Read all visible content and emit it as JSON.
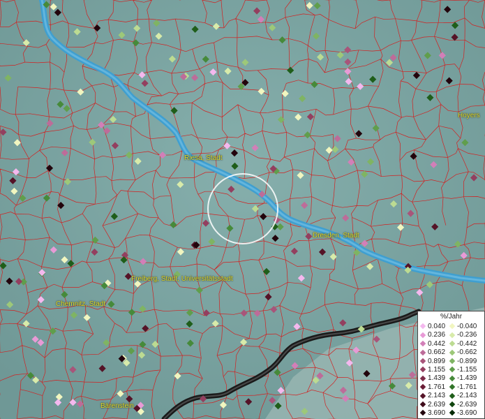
{
  "map": {
    "cities": {
      "riesa": "Riesa, Stadt",
      "dresden": "Dresden, Stadt",
      "freiberg": "Freiberg, Stadt, Universitätsstadt",
      "chemnitz": "Chemnitz, Stadt",
      "barenstein": "Bärenstein",
      "hoyers": "Hoyers"
    },
    "colors": {
      "terrain": "#7fa7a5",
      "river": "#3f9fd0",
      "boundaries": "#d22020",
      "border": "#1a1a1a",
      "selection_circle": "#ffffff"
    }
  },
  "legend": {
    "title": "%/Jahr",
    "positive": [
      {
        "label": "0.040",
        "color": "#f4b8ee"
      },
      {
        "label": "0.236",
        "color": "#e89ad6"
      },
      {
        "label": "0.442",
        "color": "#d27fb8"
      },
      {
        "label": "0.662",
        "color": "#bd6c99"
      },
      {
        "label": "0.899",
        "color": "#a8557a"
      },
      {
        "label": "1.155",
        "color": "#933f5f"
      },
      {
        "label": "1.439",
        "color": "#7d2c49"
      },
      {
        "label": "1.761",
        "color": "#6a1d36"
      },
      {
        "label": "2.143",
        "color": "#551327"
      },
      {
        "label": "2.639",
        "color": "#3e0b1a"
      },
      {
        "label": "3.690",
        "color": "#22040c"
      }
    ],
    "negative": [
      {
        "label": "-0.040",
        "color": "#f1f6c0"
      },
      {
        "label": "-0.236",
        "color": "#d8ebaa"
      },
      {
        "label": "-0.442",
        "color": "#bcdb92"
      },
      {
        "label": "-0.662",
        "color": "#9dc879"
      },
      {
        "label": "-0.899",
        "color": "#7fb463"
      },
      {
        "label": "-1.155",
        "color": "#609e4c"
      },
      {
        "label": "-1.439",
        "color": "#468a3a"
      },
      {
        "label": "-1.761",
        "color": "#317429"
      },
      {
        "label": "-2.143",
        "color": "#1f5e1a"
      },
      {
        "label": "-2.639",
        "color": "#10450e"
      },
      {
        "label": "-3.690",
        "color": "#052a05"
      }
    ]
  },
  "points": [
    {
      "v": "-0.442"
    },
    {
      "v": "0.236"
    },
    {
      "v": "-1.155"
    },
    {
      "v": "2.143"
    },
    {
      "v": "0.899"
    },
    {
      "v": "-0.236"
    },
    {
      "v": "-1.439"
    },
    {
      "v": "0.040"
    },
    {
      "v": "-0.662"
    },
    {
      "v": "1.155"
    },
    {
      "v": "-2.143"
    },
    {
      "v": "0.442"
    },
    {
      "v": "-0.899"
    },
    {
      "v": "3.690"
    },
    {
      "v": "-0.040"
    },
    {
      "v": "0.662"
    }
  ]
}
